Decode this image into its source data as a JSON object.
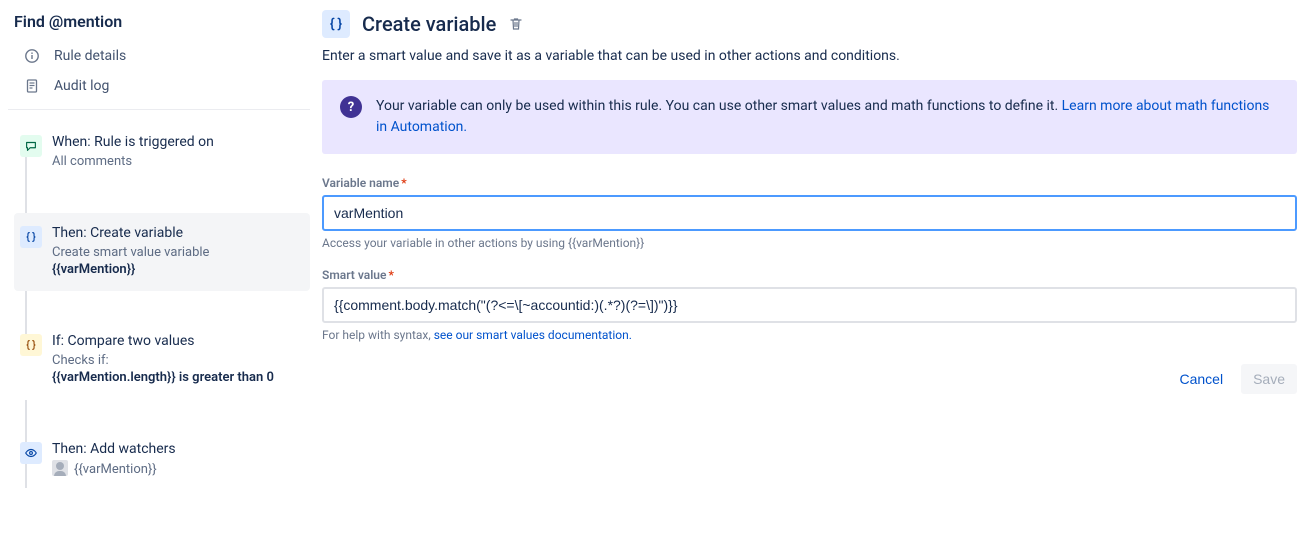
{
  "sidebar": {
    "title": "Find @mention",
    "nav": {
      "rule_details": "Rule details",
      "audit_log": "Audit log"
    },
    "steps": {
      "trigger": {
        "title": "When: Rule is triggered on",
        "desc": "All comments"
      },
      "create_var": {
        "title": "Then: Create variable",
        "desc_line1": "Create smart value variable",
        "desc_line2": "{{varMention}}"
      },
      "compare": {
        "title": "If: Compare two values",
        "desc_line1": "Checks if:",
        "desc_line2": "{{varMention.length}} is greater than 0"
      },
      "watchers": {
        "title": "Then: Add watchers",
        "desc": "{{varMention}}"
      }
    }
  },
  "main": {
    "title": "Create variable",
    "subtitle": "Enter a smart value and save it as a variable that can be used in other actions and conditions.",
    "info": {
      "text_before": "Your variable can only be used within this rule. You can use other smart values and math functions to define it. ",
      "link": "Learn more about math functions in Automation."
    },
    "fields": {
      "var_name": {
        "label": "Variable name",
        "value": "varMention",
        "help": "Access your variable in other actions by using {{varMention}}"
      },
      "smart_value": {
        "label": "Smart value",
        "value": "{{comment.body.match(\"(?<=\\[~accountid:)(.*?)(?=\\])\")}}",
        "help_before": "For help with syntax, ",
        "help_link": "see our smart values documentation."
      }
    },
    "actions": {
      "cancel": "Cancel",
      "save": "Save"
    }
  }
}
